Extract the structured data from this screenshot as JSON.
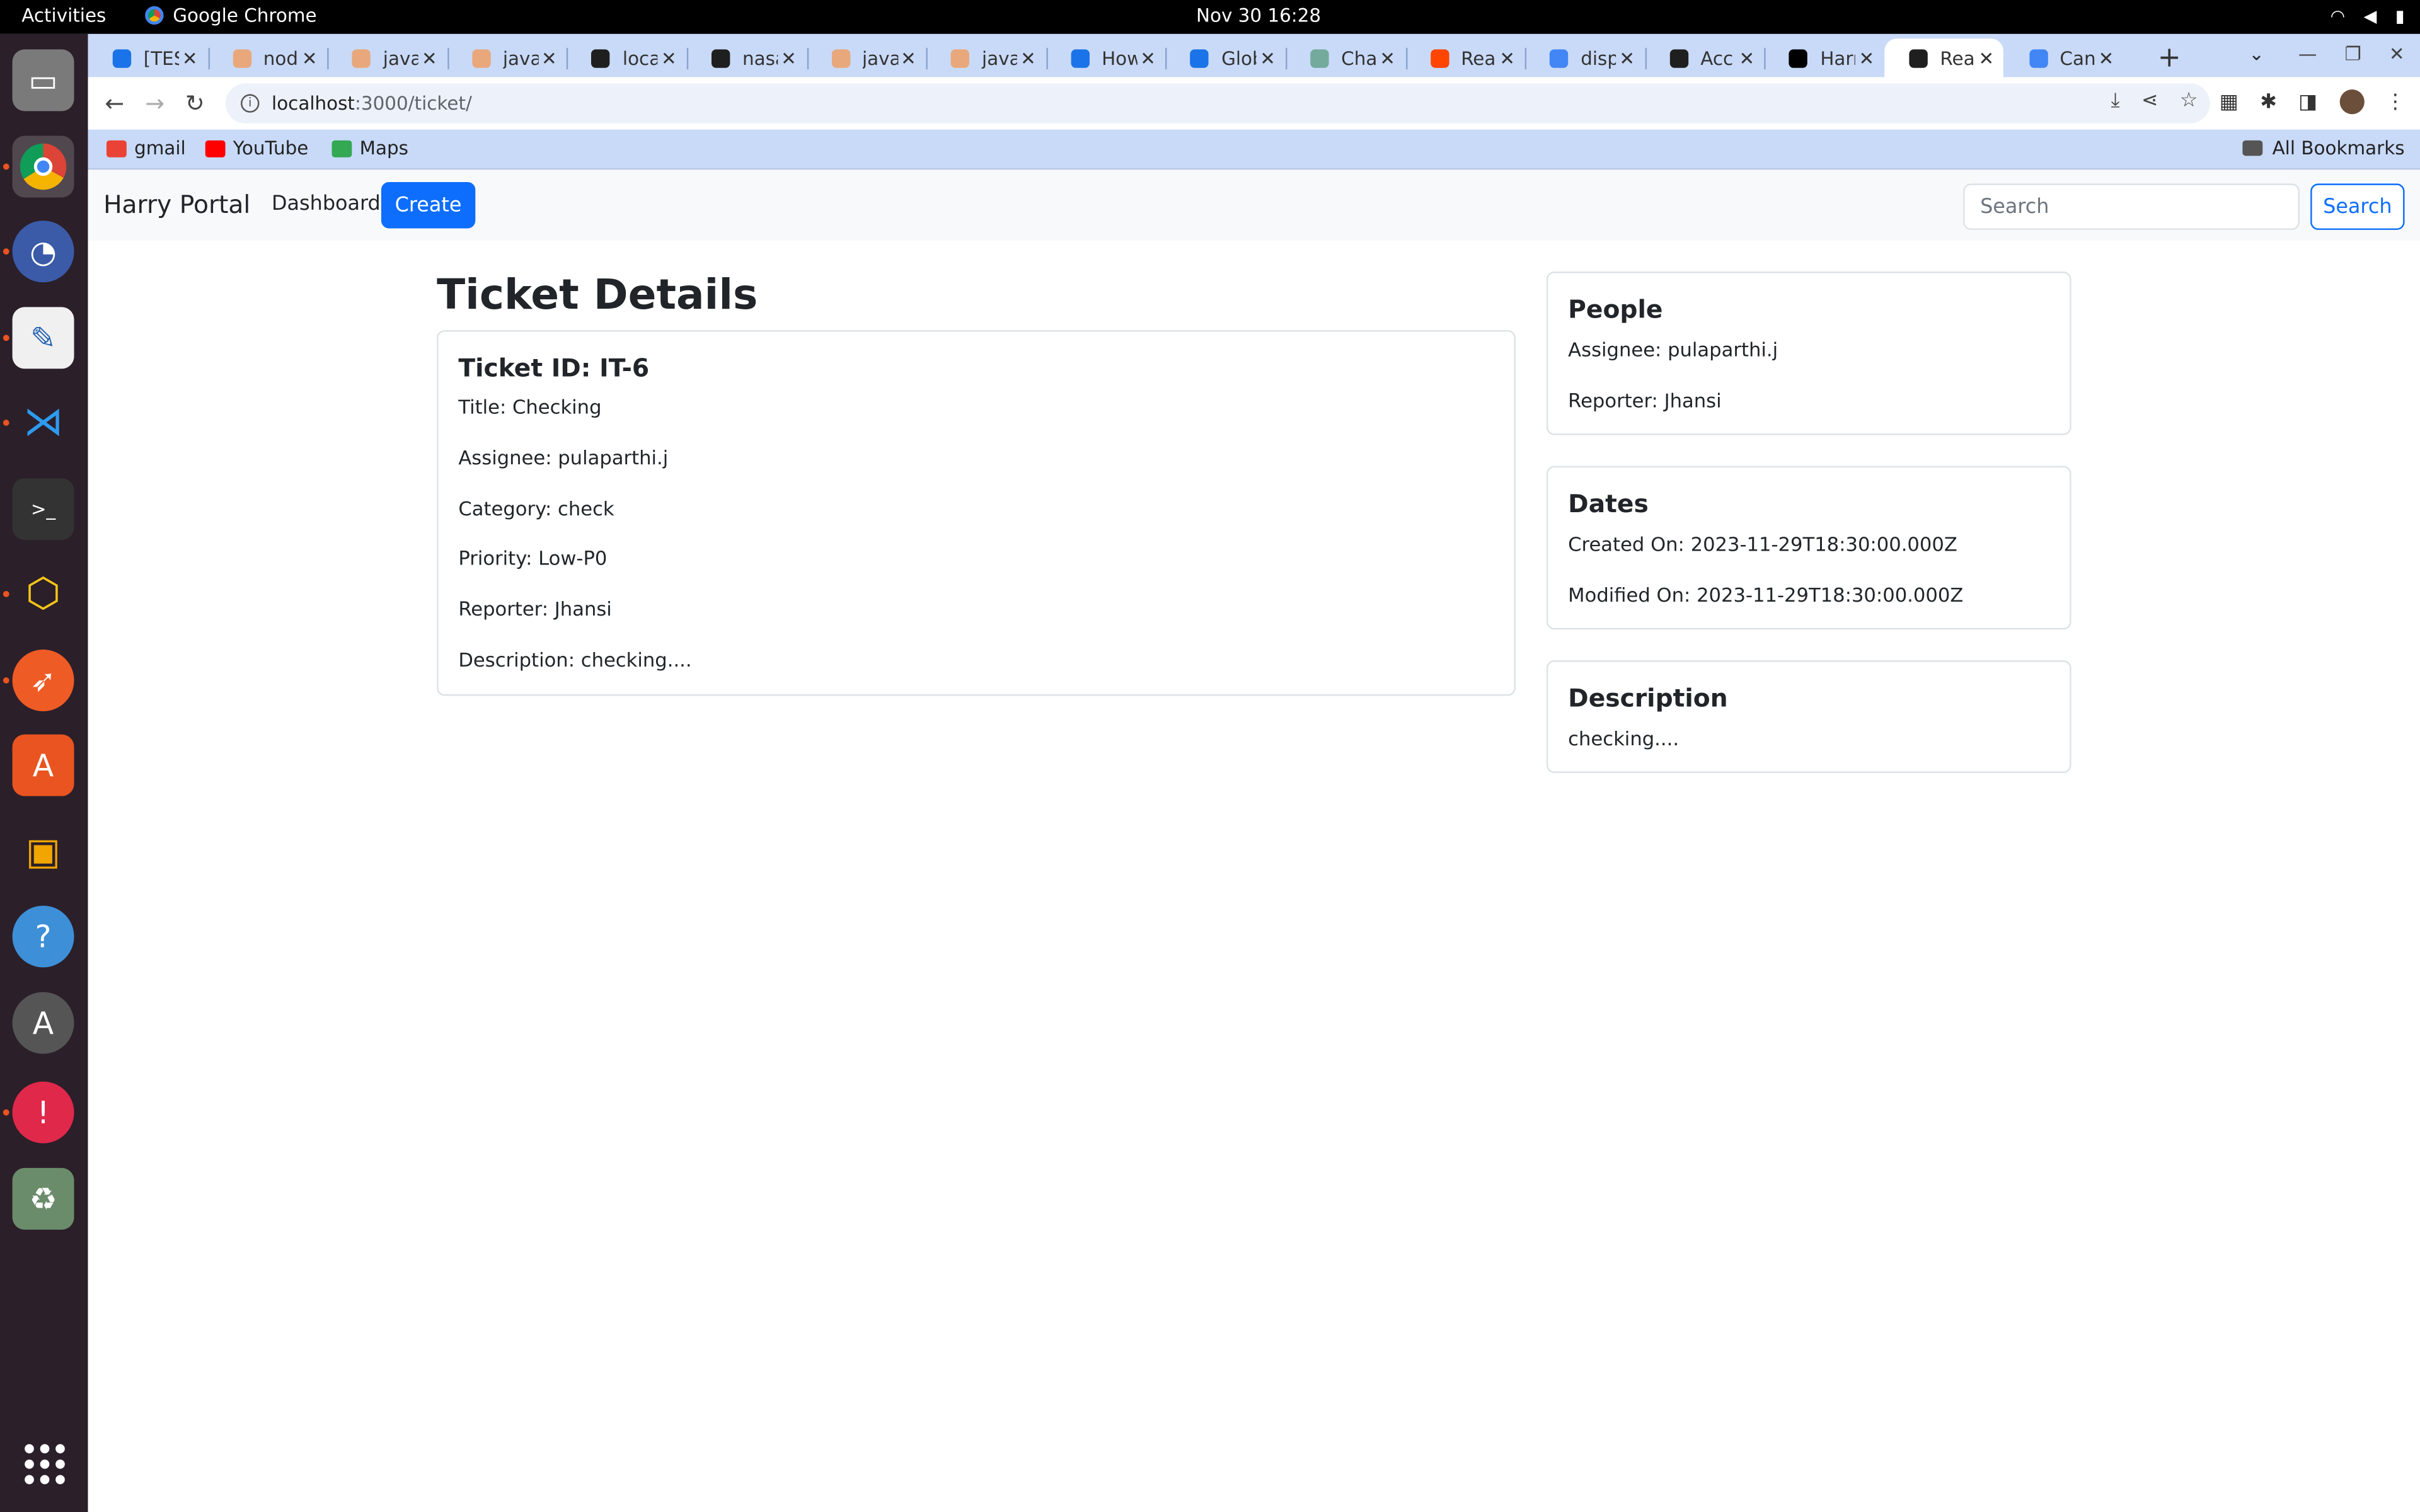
{
  "system": {
    "activities": "Activities",
    "app_name": "Google Chrome",
    "clock": "Nov 30  16:28"
  },
  "tabs": [
    {
      "title": "[TES",
      "color": "#1a73e8"
    },
    {
      "title": "nod",
      "color": "#e8a87c"
    },
    {
      "title": "java",
      "color": "#e8a87c"
    },
    {
      "title": "java",
      "color": "#e8a87c"
    },
    {
      "title": "loca",
      "color": "#1f1f1f"
    },
    {
      "title": "nasa",
      "color": "#1f1f1f"
    },
    {
      "title": "java",
      "color": "#e8a87c"
    },
    {
      "title": "java",
      "color": "#e8a87c"
    },
    {
      "title": "How",
      "color": "#1a73e8"
    },
    {
      "title": "Glob",
      "color": "#1a73e8"
    },
    {
      "title": "Cha",
      "color": "#74aa9c"
    },
    {
      "title": "Rea",
      "color": "#ff4500"
    },
    {
      "title": "disp",
      "color": "#4285f4"
    },
    {
      "title": "Acc",
      "color": "#1f1f1f"
    },
    {
      "title": "Harr",
      "color": "#000000"
    },
    {
      "title": "Rea",
      "color": "#1f1f1f",
      "active": true
    },
    {
      "title": "Can",
      "color": "#4285f4"
    }
  ],
  "address_bar": {
    "host": "localhost",
    "path": ":3000/ticket/"
  },
  "bookmarks": {
    "items": [
      {
        "label": "gmail",
        "color": "#ea4335"
      },
      {
        "label": "YouTube",
        "color": "#ff0000"
      },
      {
        "label": "Maps",
        "color": "#34a853"
      }
    ],
    "all": "All Bookmarks"
  },
  "navbar": {
    "brand": "Harry Portal",
    "dashboard": "Dashboard",
    "create": "Create",
    "search_placeholder": "Search",
    "search_button": "Search"
  },
  "ticket": {
    "heading": "Ticket Details",
    "id_line": "Ticket ID: IT-6",
    "title_line": "Title: Checking",
    "assignee_line": "Assignee: pulaparthi.j",
    "category_line": "Category: check",
    "priority_line": "Priority: Low-P0",
    "reporter_line": "Reporter: Jhansi",
    "description_line": "Description: checking...."
  },
  "people": {
    "title": "People",
    "assignee": "Assignee: pulaparthi.j",
    "reporter": "Reporter: Jhansi"
  },
  "dates": {
    "title": "Dates",
    "created": "Created On: 2023-11-29T18:30:00.000Z",
    "modified": "Modified On: 2023-11-29T18:30:00.000Z"
  },
  "description": {
    "title": "Description",
    "text": "checking...."
  },
  "colors": {
    "primary": "#0d6efd",
    "tabstrip": "#c9daf8"
  }
}
